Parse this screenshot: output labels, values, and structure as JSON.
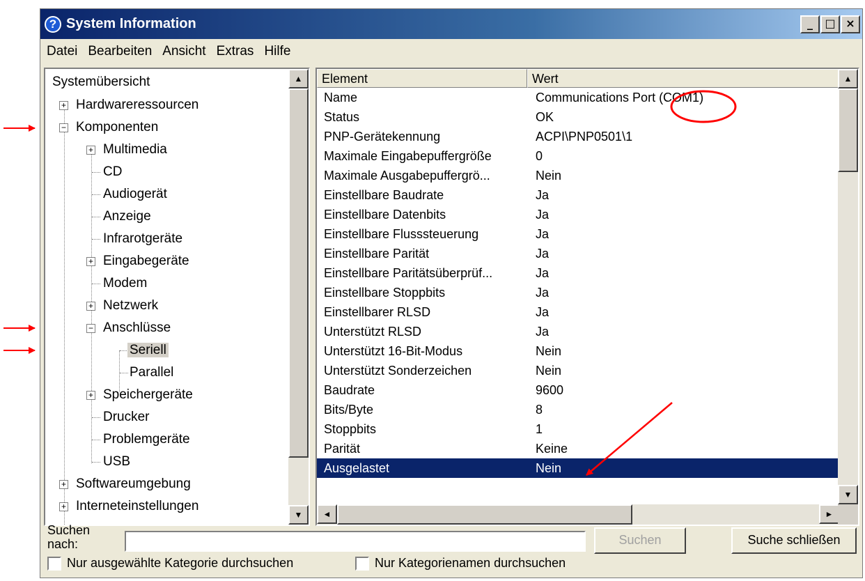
{
  "window": {
    "title": "System Information",
    "minimize": "_",
    "maximize": "□",
    "close": "×"
  },
  "menu": [
    "Datei",
    "Bearbeiten",
    "Ansicht",
    "Extras",
    "Hilfe"
  ],
  "tree": {
    "root": "Systemübersicht",
    "hardware": "Hardwareressourcen",
    "komponenten": "Komponenten",
    "multimedia": "Multimedia",
    "cd": "CD",
    "audio": "Audiogerät",
    "anzeige": "Anzeige",
    "infrarot": "Infrarotgeräte",
    "eingabe": "Eingabegeräte",
    "modem": "Modem",
    "netzwerk": "Netzwerk",
    "anschluesse": "Anschlüsse",
    "seriell": "Seriell",
    "parallel": "Parallel",
    "speicher": "Speichergeräte",
    "drucker": "Drucker",
    "problem": "Problemgeräte",
    "usb": "USB",
    "software": "Softwareumgebung",
    "internet": "Interneteinstellungen",
    "plus": "+",
    "minus": "−"
  },
  "list": {
    "col_element": "Element",
    "col_value": "Wert",
    "rows": [
      [
        "Name",
        "Communications Port (COM1)"
      ],
      [
        "Status",
        "OK"
      ],
      [
        "PNP-Gerätekennung",
        "ACPI\\PNP0501\\1"
      ],
      [
        "Maximale Eingabepuffergröße",
        "0"
      ],
      [
        "Maximale Ausgabepuffergrö...",
        "Nein"
      ],
      [
        "Einstellbare Baudrate",
        "Ja"
      ],
      [
        "Einstellbare Datenbits",
        "Ja"
      ],
      [
        "Einstellbare Flusssteuerung",
        "Ja"
      ],
      [
        "Einstellbare Parität",
        "Ja"
      ],
      [
        "Einstellbare Paritätsüberprüf...",
        "Ja"
      ],
      [
        "Einstellbare Stoppbits",
        "Ja"
      ],
      [
        "Einstellbarer RLSD",
        "Ja"
      ],
      [
        "Unterstützt RLSD",
        "Ja"
      ],
      [
        "Unterstützt 16-Bit-Modus",
        "Nein"
      ],
      [
        "Unterstützt Sonderzeichen",
        "Nein"
      ],
      [
        "Baudrate",
        "9600"
      ],
      [
        "Bits/Byte",
        "8"
      ],
      [
        "Stoppbits",
        "1"
      ],
      [
        "Parität",
        "Keine"
      ],
      [
        "Ausgelastet",
        "Nein"
      ]
    ],
    "selected_row_index": 19
  },
  "search": {
    "label_1": "Suchen",
    "label_2": "nach:",
    "value": "",
    "search_button": "Suchen",
    "close_button": "Suche schließen",
    "check_category": "Nur ausgewählte Kategorie durchsuchen",
    "check_names": "Nur Kategorienamen durchsuchen"
  },
  "scroll": {
    "up": "▲",
    "down": "▼",
    "left": "◄",
    "right": "►"
  },
  "colors": {
    "titlebar_start": "#0a246a",
    "selection": "#0a246a",
    "annotation": "#ff0000"
  }
}
